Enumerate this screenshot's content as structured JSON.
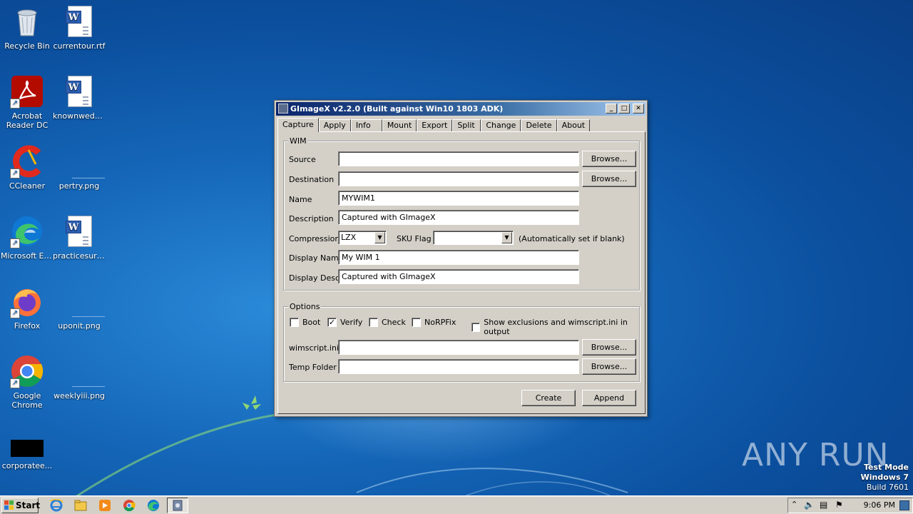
{
  "desktop": {
    "icons": [
      {
        "label": "Recycle Bin",
        "icon": "recycle-bin-icon"
      },
      {
        "label": "currentour.rtf",
        "icon": "word-doc-icon"
      },
      {
        "label": "Acrobat Reader DC",
        "icon": "acrobat-icon"
      },
      {
        "label": "knownweddi...",
        "icon": "word-doc-icon"
      },
      {
        "label": "CCleaner",
        "icon": "ccleaner-icon"
      },
      {
        "label": "pertry.png",
        "icon": "png-file-icon"
      },
      {
        "label": "Microsoft Edge",
        "icon": "edge-icon"
      },
      {
        "label": "practicesurv...",
        "icon": "word-doc-icon"
      },
      {
        "label": "Firefox",
        "icon": "firefox-icon"
      },
      {
        "label": "uponit.png",
        "icon": "png-file-icon"
      },
      {
        "label": "Google Chrome",
        "icon": "chrome-icon"
      },
      {
        "label": "weeklyiii.png",
        "icon": "png-file-icon"
      },
      {
        "label": "corporatee...",
        "icon": "black-file-icon"
      }
    ]
  },
  "window": {
    "title": "GImageX v2.2.0 (Built against Win10 1803 ADK)",
    "controls": {
      "minimize": "_",
      "maximize": "□",
      "close": "✕"
    },
    "tabs": [
      "Capture",
      "Apply",
      "Info",
      "Mount",
      "Export",
      "Split",
      "Change",
      "Delete",
      "About"
    ],
    "active_tab": "Capture",
    "wim": {
      "legend": "WIM",
      "source_label": "Source",
      "source_value": "",
      "destination_label": "Destination",
      "destination_value": "",
      "name_label": "Name",
      "name_value": "MYWIM1",
      "description_label": "Description",
      "description_value": "Captured with GImageX",
      "compression_label": "Compression",
      "compression_value": "LZX",
      "sku_label": "SKU Flag",
      "sku_value": "",
      "sku_hint": "(Automatically set if blank)",
      "display_name_label": "Display Name",
      "display_name_value": "My WIM 1",
      "display_desc_label": "Display Desc.",
      "display_desc_value": "Captured with GImageX",
      "browse_label": "Browse..."
    },
    "options": {
      "legend": "Options",
      "boot": {
        "label": "Boot",
        "checked": false
      },
      "verify": {
        "label": "Verify",
        "checked": true
      },
      "check": {
        "label": "Check",
        "checked": false
      },
      "norpfix": {
        "label": "NoRPFix",
        "checked": false
      },
      "show_exclusions": {
        "label": "Show exclusions and wimscript.ini in output",
        "checked": false
      },
      "wimscript_label": "wimscript.ini",
      "wimscript_value": "",
      "temp_label": "Temp Folder",
      "temp_value": "",
      "browse_label": "Browse..."
    },
    "create_label": "Create",
    "append_label": "Append"
  },
  "taskbar": {
    "start_label": "Start",
    "apps": [
      "ie-icon",
      "explorer-icon",
      "media-player-icon",
      "chrome-icon",
      "edge-icon",
      "gimagex-icon"
    ],
    "clock": "9:06 PM"
  },
  "watermark": "ANY RUN",
  "test_mode": {
    "line1": "Test Mode",
    "line2": "Windows 7",
    "line3": "Build 7601"
  }
}
